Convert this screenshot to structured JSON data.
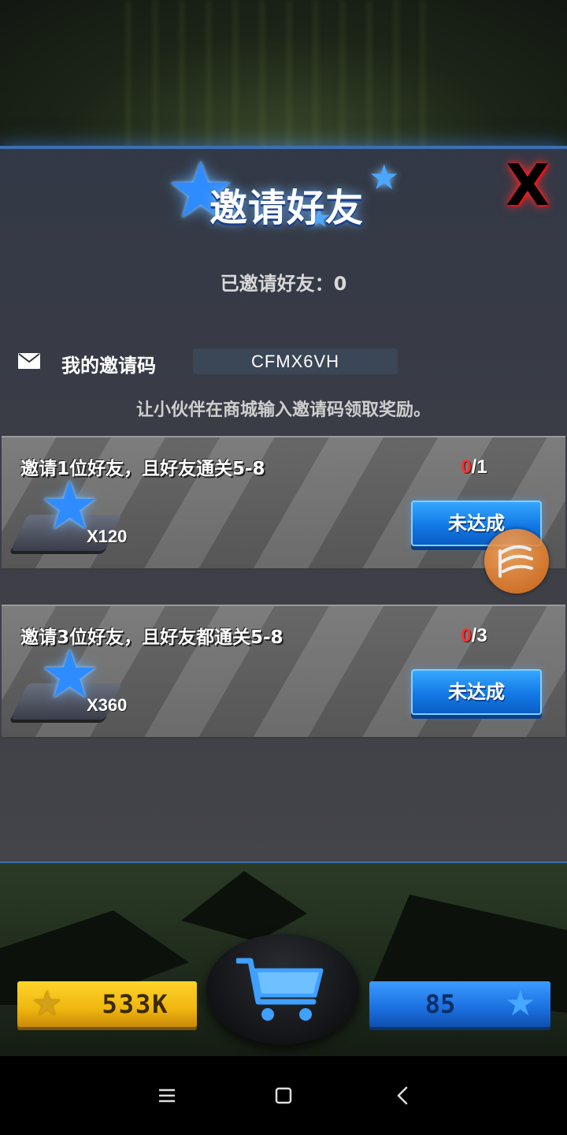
{
  "dialog": {
    "title": "邀请好友",
    "close_label": "X",
    "invited_label": "已邀请好友：0",
    "my_code_label": "我的邀请码",
    "invite_code": "CFMX6VH",
    "hint": "让小伙伴在商城输入邀请码领取奖励。"
  },
  "tasks": [
    {
      "title": "邀请1位好友，且好友通关5-8",
      "progress_current": "0",
      "progress_total": "/1",
      "reward": "X120",
      "button_label": "未达成"
    },
    {
      "title": "邀请3位好友，且好友都通关5-8",
      "progress_current": "0",
      "progress_total": "/3",
      "reward": "X360",
      "button_label": "未达成"
    }
  ],
  "resources": {
    "coins": "533K",
    "gems": "85"
  },
  "colors": {
    "accent_blue": "#2f8cff",
    "close_red": "#ff1d1d",
    "progress_red": "#ff3030",
    "coin_gold": "#f0b610"
  }
}
